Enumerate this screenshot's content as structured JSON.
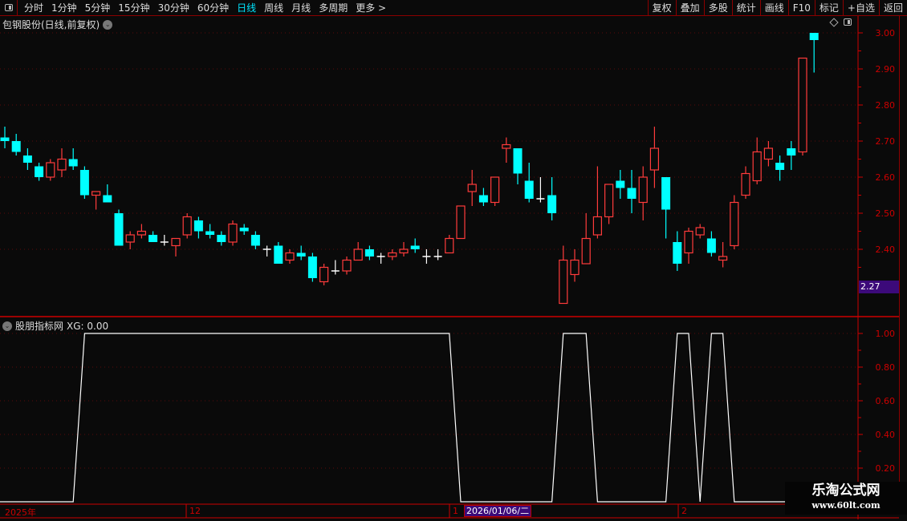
{
  "toolbar": {
    "periods": [
      "分时",
      "1分钟",
      "5分钟",
      "15分钟",
      "30分钟",
      "60分钟",
      "日线",
      "周线",
      "月线",
      "多周期",
      "更多 >"
    ],
    "active_period": "日线",
    "right_buttons": [
      "复权",
      "叠加",
      "多股",
      "统计",
      "画线",
      "F10",
      "标记",
      "+自选",
      "返回"
    ]
  },
  "chart": {
    "title": "包钢股份(日线,前复权)",
    "current_price_label": "2.27",
    "price_axis": [
      "3.00",
      "2.90",
      "2.80",
      "2.70",
      "2.60",
      "2.50",
      "2.40"
    ],
    "up_color": "#ff3b3b",
    "down_color": "#00ffff",
    "doji_color": "#ffffff",
    "axis_color": "#cc0000"
  },
  "chart_data": [
    {
      "type": "candlestick",
      "ylim": [
        2.25,
        3.0
      ],
      "ohlc": [
        [
          2.71,
          2.74,
          2.68,
          2.7
        ],
        [
          2.7,
          2.72,
          2.66,
          2.67
        ],
        [
          2.66,
          2.68,
          2.62,
          2.64
        ],
        [
          2.63,
          2.64,
          2.59,
          2.6
        ],
        [
          2.6,
          2.65,
          2.59,
          2.64
        ],
        [
          2.62,
          2.68,
          2.6,
          2.65
        ],
        [
          2.65,
          2.68,
          2.62,
          2.63
        ],
        [
          2.62,
          2.63,
          2.54,
          2.55
        ],
        [
          2.55,
          2.56,
          2.51,
          2.56
        ],
        [
          2.55,
          2.58,
          2.53,
          2.53
        ],
        [
          2.5,
          2.51,
          2.41,
          2.41
        ],
        [
          2.42,
          2.45,
          2.4,
          2.44
        ],
        [
          2.44,
          2.47,
          2.43,
          2.45
        ],
        [
          2.44,
          2.45,
          2.42,
          2.42
        ],
        [
          2.42,
          2.44,
          2.41,
          2.42
        ],
        [
          2.41,
          2.43,
          2.38,
          2.43
        ],
        [
          2.44,
          2.5,
          2.43,
          2.49
        ],
        [
          2.48,
          2.49,
          2.43,
          2.45
        ],
        [
          2.45,
          2.47,
          2.43,
          2.44
        ],
        [
          2.44,
          2.45,
          2.41,
          2.42
        ],
        [
          2.42,
          2.48,
          2.41,
          2.47
        ],
        [
          2.46,
          2.47,
          2.44,
          2.45
        ],
        [
          2.44,
          2.45,
          2.4,
          2.41
        ],
        [
          2.4,
          2.41,
          2.38,
          2.4
        ],
        [
          2.41,
          2.42,
          2.36,
          2.36
        ],
        [
          2.37,
          2.4,
          2.36,
          2.39
        ],
        [
          2.39,
          2.41,
          2.37,
          2.38
        ],
        [
          2.38,
          2.39,
          2.31,
          2.32
        ],
        [
          2.31,
          2.36,
          2.3,
          2.35
        ],
        [
          2.34,
          2.37,
          2.33,
          2.34
        ],
        [
          2.34,
          2.38,
          2.33,
          2.37
        ],
        [
          2.37,
          2.42,
          2.37,
          2.4
        ],
        [
          2.4,
          2.41,
          2.37,
          2.38
        ],
        [
          2.38,
          2.39,
          2.36,
          2.38
        ],
        [
          2.38,
          2.4,
          2.37,
          2.39
        ],
        [
          2.39,
          2.42,
          2.38,
          2.4
        ],
        [
          2.41,
          2.43,
          2.39,
          2.4
        ],
        [
          2.38,
          2.4,
          2.36,
          2.38
        ],
        [
          2.38,
          2.4,
          2.37,
          2.38
        ],
        [
          2.39,
          2.44,
          2.39,
          2.43
        ],
        [
          2.43,
          2.52,
          2.43,
          2.52
        ],
        [
          2.56,
          2.62,
          2.52,
          2.58
        ],
        [
          2.55,
          2.57,
          2.52,
          2.53
        ],
        [
          2.53,
          2.6,
          2.52,
          2.6
        ],
        [
          2.68,
          2.71,
          2.64,
          2.69
        ],
        [
          2.68,
          2.68,
          2.58,
          2.61
        ],
        [
          2.59,
          2.64,
          2.53,
          2.54
        ],
        [
          2.54,
          2.6,
          2.53,
          2.54
        ],
        [
          2.55,
          2.6,
          2.48,
          2.5
        ],
        [
          2.25,
          2.41,
          2.25,
          2.37
        ],
        [
          2.33,
          2.4,
          2.31,
          2.37
        ],
        [
          2.36,
          2.5,
          2.36,
          2.43
        ],
        [
          2.44,
          2.63,
          2.43,
          2.49
        ],
        [
          2.49,
          2.58,
          2.47,
          2.58
        ],
        [
          2.59,
          2.62,
          2.54,
          2.57
        ],
        [
          2.57,
          2.62,
          2.5,
          2.54
        ],
        [
          2.53,
          2.63,
          2.48,
          2.6
        ],
        [
          2.62,
          2.74,
          2.57,
          2.68
        ],
        [
          2.6,
          2.6,
          2.43,
          2.51
        ],
        [
          2.42,
          2.45,
          2.34,
          2.36
        ],
        [
          2.39,
          2.46,
          2.36,
          2.45
        ],
        [
          2.44,
          2.47,
          2.43,
          2.46
        ],
        [
          2.43,
          2.45,
          2.38,
          2.39
        ],
        [
          2.37,
          2.42,
          2.35,
          2.38
        ],
        [
          2.41,
          2.55,
          2.4,
          2.53
        ],
        [
          2.55,
          2.63,
          2.54,
          2.61
        ],
        [
          2.59,
          2.71,
          2.58,
          2.67
        ],
        [
          2.65,
          2.7,
          2.63,
          2.68
        ],
        [
          2.64,
          2.66,
          2.59,
          2.62
        ],
        [
          2.68,
          2.7,
          2.62,
          2.66
        ],
        [
          2.67,
          2.93,
          2.66,
          2.93
        ],
        [
          3.0,
          3.0,
          2.89,
          2.98
        ]
      ]
    },
    {
      "type": "line",
      "title": "股朋指标网",
      "series_label": "XG: 0.00",
      "ylim": [
        0,
        1.0
      ],
      "y_ticks": [
        "1.00",
        "0.80",
        "0.60",
        "0.40",
        "0.20"
      ],
      "values": [
        0,
        0,
        0,
        0,
        0,
        0,
        0,
        1,
        1,
        1,
        1,
        1,
        1,
        1,
        1,
        1,
        1,
        1,
        1,
        1,
        1,
        1,
        1,
        1,
        1,
        1,
        1,
        1,
        1,
        1,
        1,
        1,
        1,
        1,
        1,
        1,
        1,
        1,
        1,
        1,
        0,
        0,
        0,
        0,
        0,
        0,
        0,
        0,
        0,
        1,
        1,
        1,
        0,
        0,
        0,
        0,
        0,
        0,
        0,
        1,
        1,
        0,
        1,
        1,
        0,
        0,
        0,
        0,
        0,
        0,
        0,
        0
      ]
    }
  ],
  "date_axis": {
    "labels": [
      "2025年",
      "12",
      "1",
      "2"
    ],
    "cursor_date": "2026/01/06/二"
  },
  "watermark": {
    "title": "乐淘公式网",
    "url": "www.60lt.com"
  }
}
